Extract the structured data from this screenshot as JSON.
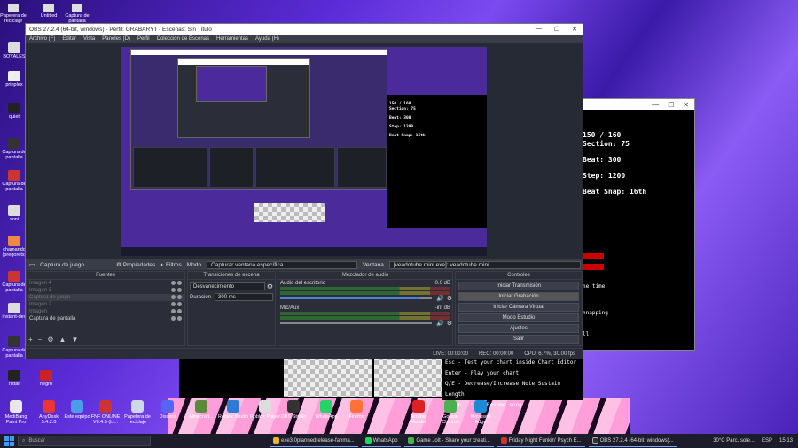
{
  "desktop_top_icons": [
    {
      "label": "Papelera de reciclaje"
    },
    {
      "label": "Untitled"
    },
    {
      "label": "Captura de pantalla"
    }
  ],
  "desktop_left_icons": [
    {
      "label": "BOYALES"
    },
    {
      "label": "prinplex"
    },
    {
      "label": "quiet"
    },
    {
      "label": "Captura de pantalla"
    },
    {
      "label": "Captura de pantalla"
    },
    {
      "label": "soni"
    },
    {
      "label": "chamando (pregorets)"
    },
    {
      "label": "Captura de pantalla"
    },
    {
      "label": "instant-dev"
    },
    {
      "label": "Captura de pantalla"
    },
    {
      "label": "ristar"
    },
    {
      "label": "negro"
    }
  ],
  "obs": {
    "title": "OBS 27.2.4 (64-bit, windows) - Perfil: GRABARYT - Escenas: Sin Título",
    "menu": [
      "Archivo (F)",
      "Editar",
      "Vista",
      "Paneles (D)",
      "Perfil",
      "Colección de Escenas",
      "Herramientas",
      "Ayuda (H)"
    ],
    "source_bar": {
      "source": "Captura de juego",
      "properties": "Propiedades",
      "filters": "Filtros",
      "mode_label": "Modo",
      "mode_value": "Capturar ventana específica",
      "window_label": "Ventana",
      "window_value": "[veadotube mini.exe]: veadotube mini"
    },
    "sources": {
      "header": "Fuentes",
      "items": [
        {
          "name": "Imagen 4",
          "dim": true
        },
        {
          "name": "Imagen 3",
          "dim": true
        },
        {
          "name": "Captura de juego",
          "dim": true
        },
        {
          "name": "Imagen 2",
          "dim": true
        },
        {
          "name": "Imagen",
          "dim": true
        },
        {
          "name": "Captura de pantalla",
          "dim": false
        }
      ]
    },
    "transitions": {
      "header": "Transiciones de escena",
      "type": "Desvanecimiento",
      "duration_label": "Duración",
      "duration_value": "300 ms"
    },
    "mixer": {
      "header": "Mezclador de audio",
      "channels": [
        {
          "name": "Audio del escritorio",
          "db": "0.0 dB",
          "volume": 0.92
        },
        {
          "name": "Mic/Aux",
          "db": "-inf dB",
          "volume": 0.0
        }
      ]
    },
    "controls": {
      "header": "Controles",
      "buttons": [
        "Iniciar Transmisión",
        "Iniciar Grabación",
        "Iniciar Cámara Virtual",
        "Modo Estudio",
        "Ajustes",
        "Salir"
      ]
    },
    "status": {
      "live": "LIVE: 00:00:00",
      "rec": "REC: 00:00:00",
      "cpu": "CPU: 6.7%, 30.00 fps"
    }
  },
  "game": {
    "stats": [
      "150 / 160",
      "Section: 75",
      "Beat: 300",
      "Step: 1200",
      "Beat Snap: 16th"
    ],
    "notes": [
      "ne time",
      "nnapping",
      "ll"
    ],
    "help": [
      "Esc - Test your chart inside Chart Editor",
      "Enter - Play your chart",
      "Q/E - Decrease/Increase Note Sustain Length",
      "Space - Stop/Resume song"
    ]
  },
  "taskbar_icons": [
    {
      "label": "MediBang Paint Pro",
      "color": "#e8e8e8"
    },
    {
      "label": "AnyDesk 5.4.2.0",
      "color": "#e33"
    },
    {
      "label": "Este equipo",
      "color": "#4a9de8"
    },
    {
      "label": "FNF ONLINE V0.4.5 (Li...",
      "color": "#c33"
    },
    {
      "label": "Papelera de reciclaje",
      "color": "#cfd8e8"
    },
    {
      "label": "Discord",
      "color": "#5865f2"
    },
    {
      "label": "Minecraft...",
      "color": "#5a8a3a"
    },
    {
      "label": "Roblox Studio",
      "color": "#2a7ad8"
    },
    {
      "label": "Roblox Player",
      "color": "#ddd"
    },
    {
      "label": "OBS Studio",
      "color": "#333"
    },
    {
      "label": "WhatsApp",
      "color": "#25d366"
    },
    {
      "label": "Firefox",
      "color": "#ff7139"
    },
    {
      "label": "Acrobat Reader",
      "color": "#d22"
    },
    {
      "label": "Google Chrome",
      "color": "#4caf50"
    },
    {
      "label": "Microsoft Edge",
      "color": "#1a8ad8"
    }
  ],
  "taskbar": {
    "search": "Buscar",
    "tasks": [
      {
        "label": "exe3.0plannedrelease-fanma...",
        "color": "#e8b82a"
      },
      {
        "label": "WhatsApp",
        "color": "#25d366"
      },
      {
        "label": "Game Jolt - Share your creati...",
        "color": "#4caf50"
      },
      {
        "label": "Friday Night Funkin' Psych E...",
        "color": "#c33"
      },
      {
        "label": "OBS 27.2.4 (64-bit, windows)...",
        "color": "#333"
      }
    ],
    "weather": "30°C Parc. sole...",
    "lang": "ESP",
    "time": "15:13"
  }
}
